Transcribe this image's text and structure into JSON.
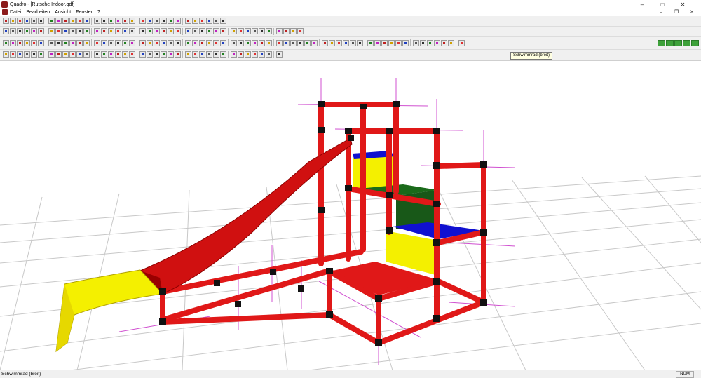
{
  "window": {
    "title": "Quadro - [Rutsche Indoor.qdf]"
  },
  "window_controls": {
    "minimize": "–",
    "maximize": "□",
    "close": "✕"
  },
  "menu": {
    "items": [
      "Datei",
      "Bearbeiten",
      "Ansicht",
      "Fenster",
      "?"
    ]
  },
  "mdi_controls": {
    "minimize": "–",
    "restore": "❐",
    "close": "✕"
  },
  "tooltip": {
    "text": "Schwimmrad (breit)"
  },
  "statusbar": {
    "text": "Schwimmrad (breit)",
    "num": "NUM"
  },
  "colors": {
    "frame_red": "#e01818",
    "slide_red": "#d01010",
    "yellow": "#f4f000",
    "blue": "#1010d0",
    "green": "#1a6a1a",
    "joint": "#111111",
    "guide_magenta": "#d050d0",
    "grid": "#c8c8c8"
  },
  "toolbars": [
    {
      "name": "toolbar-1",
      "icons": [
        "new-icon",
        "open-icon",
        "save-icon",
        "print-icon",
        "preview-icon",
        "print-setup-icon",
        "cut-icon",
        "copy-icon",
        "paste-icon",
        "delete-icon",
        "undo-icon",
        "redo-icon",
        "select-icon",
        "zoom-icon",
        "panel-35-icon",
        "panel-icon",
        "plate-icon",
        "slide-icon",
        "wheel-icon",
        "box-icon",
        "red-block-icon",
        "paint-icon",
        "layers-icon",
        "cross-icon",
        "bar-icon",
        "bar-blue-icon",
        "view-3d-icon",
        "view-front-icon",
        "view-side-icon",
        "view-top-icon"
      ]
    },
    {
      "name": "toolbar-2",
      "icons": [
        "person-icon",
        "bulb-icon",
        "person-icon",
        "person-icon",
        "eye-icon",
        "arrows-icon",
        "arrows-icon",
        "arrows-icon",
        "arrows-icon",
        "arrows-icon",
        "box-red-icon",
        "panel-35-icon",
        "panel-35-icon",
        "panel-25-icon",
        "panel-icon",
        "slide-icon",
        "slide-icon",
        "wheel-icon",
        "wheel-icon",
        "tube-icon",
        "blue-ball-icon",
        "blue-ball-icon",
        "blue-bar-icon",
        "blue-bar-icon",
        "blue-bar-icon",
        "blue-bar-icon",
        "tool-icon",
        "tool-icon",
        "tool-icon",
        "tool-icon",
        "cross-icon",
        "rope-icon",
        "rope-icon",
        "rope-icon",
        "rope-icon",
        "swing-icon",
        "blue-square-icon",
        "black-square-icon",
        "square-icon",
        "square-icon"
      ]
    },
    {
      "name": "toolbar-3",
      "icons": [
        "tool-icon",
        "tool-icon",
        "pink-icon",
        "tool-icon",
        "tool-icon",
        "pipe-icon",
        "pipe-icon",
        "box-icon",
        "box-icon",
        "plus-icon",
        "stripe-icon",
        "cross-icon",
        "panel-icon",
        "grid-icon",
        "mail-icon",
        "grid-icon",
        "grid-icon",
        "plus-red-icon",
        "plus-red-icon",
        "plus-red-icon",
        "joint-icon",
        "joint-icon",
        "joint-icon",
        "grid-icon",
        "circle-icon",
        "square-icon",
        "plus-icon",
        "joint-icon",
        "joint-icon",
        "joint-icon",
        "joint-icon",
        "joint-icon",
        "joint-icon",
        "joint-icon",
        "joint-icon",
        "lock-icon",
        "connector-icon",
        "connector-icon",
        "connector-icon",
        "connector-icon",
        "tube-icon",
        "tube-icon",
        "tube-icon",
        "tube-icon",
        "tube-icon",
        "red-ball-icon",
        "red-ball-icon",
        "tube-icon",
        "tube-icon",
        "tube-icon",
        "tube-icon",
        "tube-icon",
        "red-bar-icon",
        "red-bar-icon",
        "red-bar-icon",
        "red-icon",
        "red-icon",
        "red-icon",
        "red-icon",
        "red-icon",
        "red-icon"
      ]
    },
    {
      "name": "toolbar-4",
      "icons": [
        "view-icon",
        "view-icon",
        "view-icon",
        "cube-icon",
        "cube-icon",
        "cube-icon",
        "cube-icon",
        "cube-icon",
        "cube-icon",
        "cube-icon",
        "cube-icon",
        "move-icon",
        "move-icon",
        "move-icon",
        "move-icon",
        "cube-icon",
        "cube-icon",
        "cube-icon",
        "cube-icon",
        "step-5-icon",
        "step-10-icon",
        "step-20-icon",
        "step-40-icon",
        "step-80-icon",
        "align-icon",
        "align-icon",
        "align-icon",
        "align-icon",
        "align-icon",
        "align-icon",
        "align-icon",
        "align-icon",
        "align-icon",
        "align-icon",
        "align-icon",
        "align-icon",
        "align-icon"
      ]
    }
  ],
  "nav_buttons": [
    "rotate-left-icon",
    "rotate-up-icon",
    "rotate-down-icon",
    "rotate-right-icon",
    "zoom-fit-icon"
  ]
}
